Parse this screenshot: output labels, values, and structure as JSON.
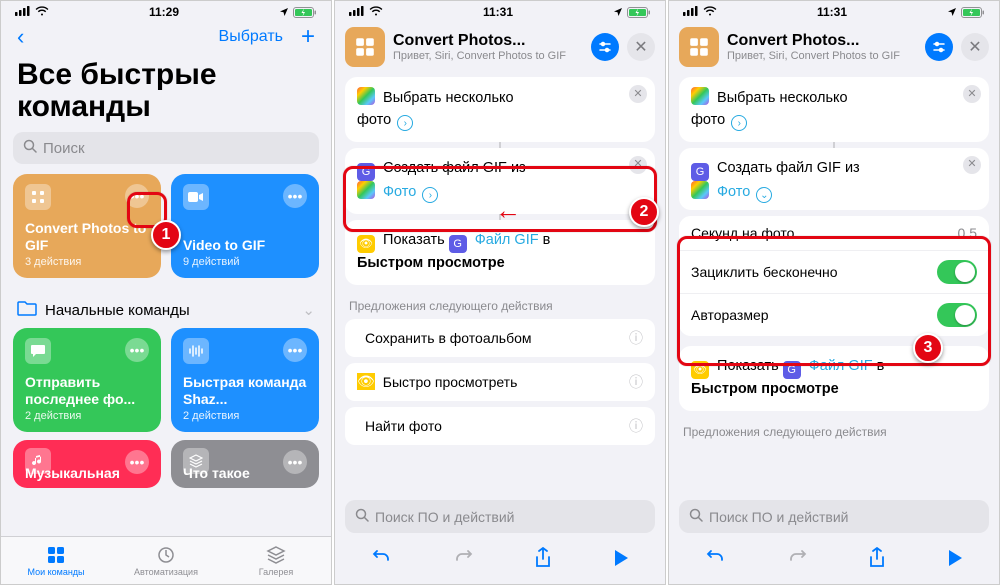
{
  "screen1": {
    "time": "11:29",
    "select_label": "Выбрать",
    "title": "Все быстрые команды",
    "search_placeholder": "Поиск",
    "tile1_title": "Convert Photos to GIF",
    "tile1_sub": "3 действия",
    "tile2_title": "Video to GIF",
    "tile2_sub": "9 действий",
    "folder_label": "Начальные команды",
    "tile3_title": "Отправить последнее фо...",
    "tile3_sub": "2 действия",
    "tile4_title": "Быстрая команда Shaz...",
    "tile4_sub": "2 действия",
    "tile5_title": "Музыкальная",
    "tile6_title": "Что такое",
    "tab1": "Мои команды",
    "tab2": "Автоматизация",
    "tab3": "Галерея"
  },
  "screen2": {
    "time": "11:31",
    "title": "Convert Photos...",
    "subtitle": "Привет, Siri, Convert Photos to GIF",
    "a1_pre": "Выбрать несколько",
    "a1_post": "фото",
    "a2_pre": "Создать файл GIF из",
    "a2_var": "Фото",
    "a3_pre": "Показать",
    "a3_var": "Файл GIF",
    "a3_post": "в",
    "a3_line2": "Быстром просмотре",
    "sugg_head": "Предложения следующего действия",
    "s1": "Сохранить в фотоальбом",
    "s2": "Быстро просмотреть",
    "s3": "Найти фото",
    "search_placeholder": "Поиск ПО и действий"
  },
  "screen3": {
    "time": "11:31",
    "p1_label": "Секунд на фото",
    "p1_value": "0.5",
    "p2_label": "Зациклить бесконечно",
    "p3_label": "Авторазмер"
  },
  "badges": {
    "b1": "1",
    "b2": "2",
    "b3": "3"
  }
}
